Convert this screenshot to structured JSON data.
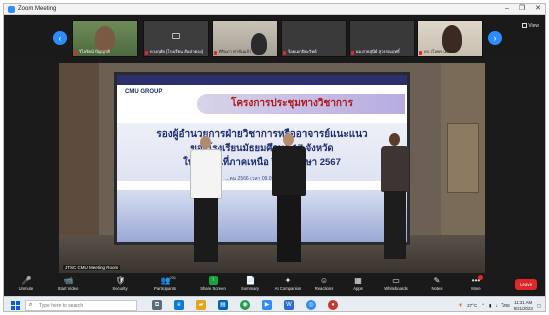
{
  "window": {
    "title": "Zoom Meeting",
    "controls": [
      "–",
      "❐",
      "✕"
    ]
  },
  "gallery": {
    "view_label": "View",
    "tiles": [
      {
        "name": "วิไลรัตน์ ปัญญาดี"
      },
      {
        "name": "ดวงฤทัย (โรงเรียน สันป่าตอง)"
      },
      {
        "name": "ศิรินภา ท่าขันแก้ว"
      },
      {
        "name": "ร้อยเอกปิยะวิทย์"
      },
      {
        "name": "ผอ.สายสุนีย์ สุวรรณฤทธิ์"
      },
      {
        "name": "ดร.วไลพร แสนคำ"
      }
    ]
  },
  "stage": {
    "slide": {
      "logo": "CMU GROUP",
      "headline": "โครงการประชุมทางวิชาการ",
      "line1": "รองผู้อำนวยการฝ่ายวิชาการหรืออาจารย์แนะแนว",
      "line2": "ของโรงเรียนมัธยมศึกษา 17 จังหวัด",
      "line3": "ในเขตพื้นที่ภาคเหนือ ปีการศึกษา 2567",
      "subinfo": "...คม 2566 เวลา 09.00 – 12.00 น."
    },
    "caption": "JTSC CMU Meeting Room"
  },
  "toolbar": {
    "items": [
      {
        "label": "Unmute",
        "icon": "🎤"
      },
      {
        "label": "Start Video",
        "icon": "📹"
      },
      {
        "label": "Security",
        "icon": "🛡"
      },
      {
        "label": "Participants",
        "icon": "👥",
        "count": "231"
      },
      {
        "label": "Share Screen",
        "icon": "↑"
      },
      {
        "label": "Summary",
        "icon": "📄"
      },
      {
        "label": "AI Companion",
        "icon": "✦"
      },
      {
        "label": "Reactions",
        "icon": "☺"
      },
      {
        "label": "Apps",
        "icon": "▦"
      },
      {
        "label": "Whiteboards",
        "icon": "▭"
      },
      {
        "label": "Notes",
        "icon": "✎"
      },
      {
        "label": "More",
        "icon": "•••"
      }
    ],
    "leave_label": "Leave"
  },
  "taskbar": {
    "search_placeholder": "Type here to search",
    "weather": "27°C",
    "time": "11:31 AM",
    "date": "9/21/2023"
  }
}
